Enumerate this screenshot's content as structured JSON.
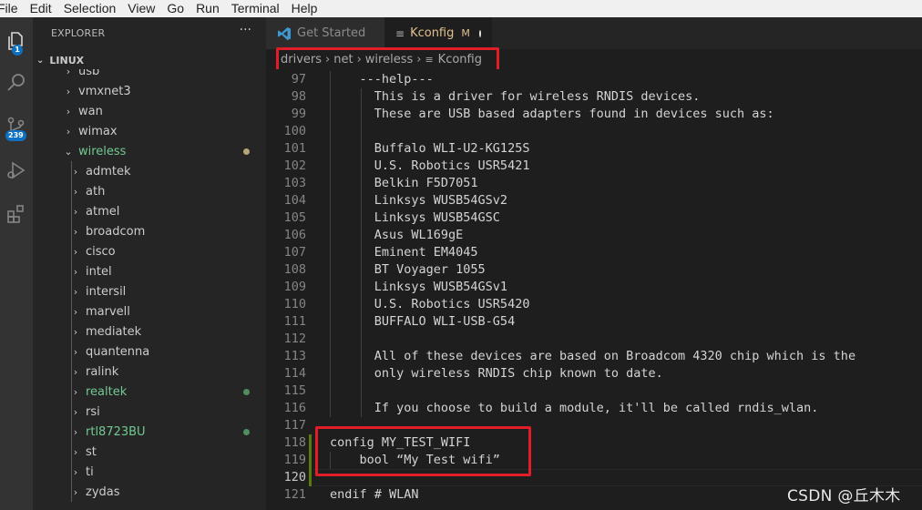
{
  "menu": [
    "File",
    "Edit",
    "Selection",
    "View",
    "Go",
    "Run",
    "Terminal",
    "Help"
  ],
  "activity": {
    "explorer_badge": "1",
    "source_control_badge": "239"
  },
  "explorer": {
    "title": "EXPLORER",
    "more": "···",
    "root": "LINUX",
    "items": [
      {
        "label": "usb",
        "level": 1,
        "open": false,
        "color": "#cccccc"
      },
      {
        "label": "vmxnet3",
        "level": 1,
        "open": false,
        "color": "#cccccc"
      },
      {
        "label": "wan",
        "level": 1,
        "open": false,
        "color": "#cccccc"
      },
      {
        "label": "wimax",
        "level": 1,
        "open": false,
        "color": "#cccccc"
      },
      {
        "label": "wireless",
        "level": 1,
        "open": true,
        "color": "#73c991",
        "dot": "#b5a773"
      },
      {
        "label": "admtek",
        "level": 2,
        "open": false,
        "color": "#cccccc"
      },
      {
        "label": "ath",
        "level": 2,
        "open": false,
        "color": "#cccccc"
      },
      {
        "label": "atmel",
        "level": 2,
        "open": false,
        "color": "#cccccc"
      },
      {
        "label": "broadcom",
        "level": 2,
        "open": false,
        "color": "#cccccc"
      },
      {
        "label": "cisco",
        "level": 2,
        "open": false,
        "color": "#cccccc"
      },
      {
        "label": "intel",
        "level": 2,
        "open": false,
        "color": "#cccccc"
      },
      {
        "label": "intersil",
        "level": 2,
        "open": false,
        "color": "#cccccc"
      },
      {
        "label": "marvell",
        "level": 2,
        "open": false,
        "color": "#cccccc"
      },
      {
        "label": "mediatek",
        "level": 2,
        "open": false,
        "color": "#cccccc"
      },
      {
        "label": "quantenna",
        "level": 2,
        "open": false,
        "color": "#cccccc"
      },
      {
        "label": "ralink",
        "level": 2,
        "open": false,
        "color": "#cccccc"
      },
      {
        "label": "realtek",
        "level": 2,
        "open": false,
        "color": "#73c991",
        "dot": "#4e8e5f"
      },
      {
        "label": "rsi",
        "level": 2,
        "open": false,
        "color": "#cccccc"
      },
      {
        "label": "rtl8723BU",
        "level": 2,
        "open": false,
        "color": "#73c991",
        "dot": "#4e8e5f"
      },
      {
        "label": "st",
        "level": 2,
        "open": false,
        "color": "#cccccc"
      },
      {
        "label": "ti",
        "level": 2,
        "open": false,
        "color": "#cccccc"
      },
      {
        "label": "zydas",
        "level": 2,
        "open": false,
        "color": "#cccccc"
      }
    ]
  },
  "tabs": {
    "get_started": "Get Started",
    "kconfig": "Kconfig",
    "kconfig_modified": "M"
  },
  "breadcrumbs": [
    "drivers",
    "net",
    "wireless",
    "Kconfig"
  ],
  "editor": {
    "lines": [
      {
        "n": "97",
        "text": "    ---help---"
      },
      {
        "n": "98",
        "text": "      This is a driver for wireless RNDIS devices."
      },
      {
        "n": "99",
        "text": "      These are USB based adapters found in devices such as:"
      },
      {
        "n": "100",
        "text": ""
      },
      {
        "n": "101",
        "text": "      Buffalo WLI-U2-KG125S"
      },
      {
        "n": "102",
        "text": "      U.S. Robotics USR5421"
      },
      {
        "n": "103",
        "text": "      Belkin F5D7051"
      },
      {
        "n": "104",
        "text": "      Linksys WUSB54GSv2"
      },
      {
        "n": "105",
        "text": "      Linksys WUSB54GSC"
      },
      {
        "n": "106",
        "text": "      Asus WL169gE"
      },
      {
        "n": "107",
        "text": "      Eminent EM4045"
      },
      {
        "n": "108",
        "text": "      BT Voyager 1055"
      },
      {
        "n": "109",
        "text": "      Linksys WUSB54GSv1"
      },
      {
        "n": "110",
        "text": "      U.S. Robotics USR5420"
      },
      {
        "n": "111",
        "text": "      BUFFALO WLI-USB-G54"
      },
      {
        "n": "112",
        "text": ""
      },
      {
        "n": "113",
        "text": "      All of these devices are based on Broadcom 4320 chip which is the"
      },
      {
        "n": "114",
        "text": "      only wireless RNDIS chip known to date."
      },
      {
        "n": "115",
        "text": ""
      },
      {
        "n": "116",
        "text": "      If you choose to build a module, it'll be called rndis_wlan."
      },
      {
        "n": "117",
        "text": ""
      },
      {
        "n": "118",
        "text": "config MY_TEST_WIFI"
      },
      {
        "n": "119",
        "text": "    bool “My Test wifi”"
      },
      {
        "n": "120",
        "text": ""
      },
      {
        "n": "121",
        "text": "endif # WLAN"
      }
    ]
  },
  "watermark": "CSDN @丘木木"
}
